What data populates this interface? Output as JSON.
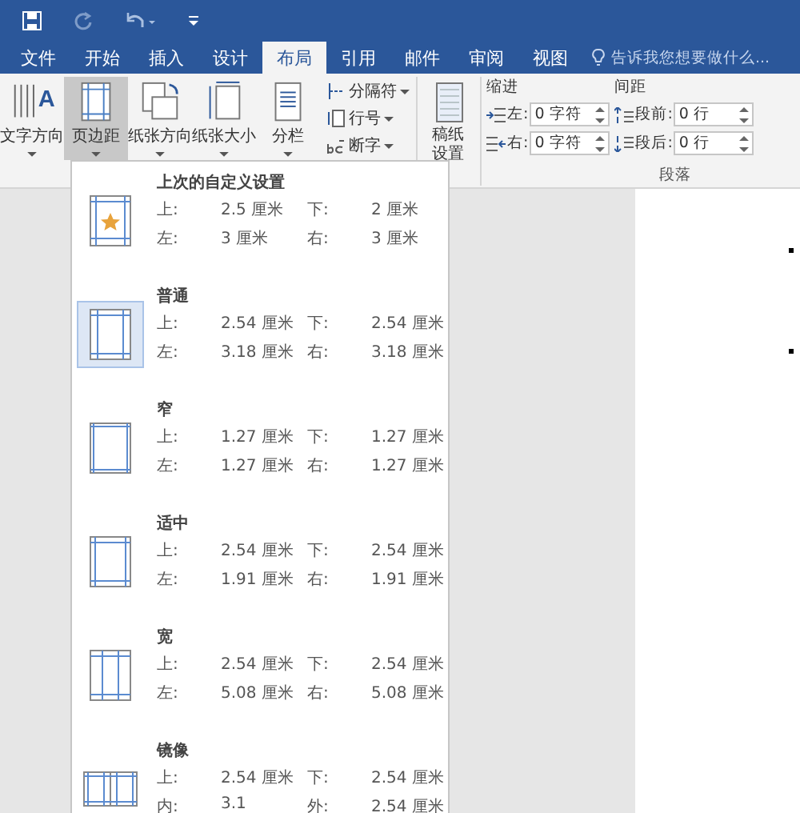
{
  "tabs": [
    {
      "label": "文件",
      "selected": false
    },
    {
      "label": "开始",
      "selected": false
    },
    {
      "label": "插入",
      "selected": false
    },
    {
      "label": "设计",
      "selected": false
    },
    {
      "label": "布局",
      "selected": true
    },
    {
      "label": "引用",
      "selected": false
    },
    {
      "label": "邮件",
      "selected": false
    },
    {
      "label": "审阅",
      "selected": false
    },
    {
      "label": "视图",
      "selected": false
    }
  ],
  "tell_me": {
    "placeholder": "告诉我您想要做什么..."
  },
  "ribbon": {
    "large_buttons": [
      {
        "label": "文字方向",
        "kind": "text-direction",
        "glyph": "A",
        "selected": false
      },
      {
        "label": "页边距",
        "kind": "margins",
        "selected": true
      },
      {
        "label": "纸张方向",
        "kind": "orientation",
        "selected": false
      },
      {
        "label": "纸张大小",
        "kind": "size",
        "selected": false
      },
      {
        "label": "分栏",
        "kind": "columns",
        "selected": false
      }
    ],
    "small_buttons": [
      {
        "label": "分隔符",
        "kind": "breaks"
      },
      {
        "label": "行号",
        "kind": "line-numbers"
      },
      {
        "label": "断字",
        "kind": "hyphenation"
      }
    ],
    "paper_button": "稿纸设置",
    "indent": {
      "title": "缩进",
      "fields": [
        {
          "label": "左:",
          "value": "0 字符",
          "kind": "left"
        },
        {
          "label": "右:",
          "value": "0 字符",
          "kind": "right"
        }
      ]
    },
    "spacing": {
      "title": "间距",
      "fields": [
        {
          "label": "段前:",
          "value": "0 行",
          "kind": "before"
        },
        {
          "label": "段后:",
          "value": "0 行",
          "kind": "after"
        }
      ]
    },
    "group_label": "段落"
  },
  "margins_menu": {
    "items": [
      {
        "name": "上次的自定义设置",
        "kind": "custom",
        "selected": false,
        "rows": [
          [
            "上:",
            "2.5 厘米",
            "下:",
            "2 厘米"
          ],
          [
            "左:",
            "3 厘米",
            "右:",
            "3 厘米"
          ]
        ]
      },
      {
        "name": "普通",
        "kind": "normal",
        "selected": true,
        "rows": [
          [
            "上:",
            "2.54 厘米",
            "下:",
            "2.54 厘米"
          ],
          [
            "左:",
            "3.18 厘米",
            "右:",
            "3.18 厘米"
          ]
        ]
      },
      {
        "name": "窄",
        "kind": "narrow",
        "selected": false,
        "rows": [
          [
            "上:",
            "1.27 厘米",
            "下:",
            "1.27 厘米"
          ],
          [
            "左:",
            "1.27 厘米",
            "右:",
            "1.27 厘米"
          ]
        ]
      },
      {
        "name": "适中",
        "kind": "moderate",
        "selected": false,
        "rows": [
          [
            "上:",
            "2.54 厘米",
            "下:",
            "2.54 厘米"
          ],
          [
            "左:",
            "1.91 厘米",
            "右:",
            "1.91 厘米"
          ]
        ]
      },
      {
        "name": "宽",
        "kind": "wide",
        "selected": false,
        "rows": [
          [
            "上:",
            "2.54 厘米",
            "下:",
            "2.54 厘米"
          ],
          [
            "左:",
            "5.08 厘米",
            "右:",
            "5.08 厘米"
          ]
        ]
      },
      {
        "name": "镜像",
        "kind": "mirrored",
        "selected": false,
        "rows": [
          [
            "上:",
            "2.54 厘米",
            "下:",
            "2.54 厘米"
          ],
          [
            "内:",
            "3.1",
            "外:",
            "2.54 厘米"
          ]
        ]
      }
    ]
  }
}
